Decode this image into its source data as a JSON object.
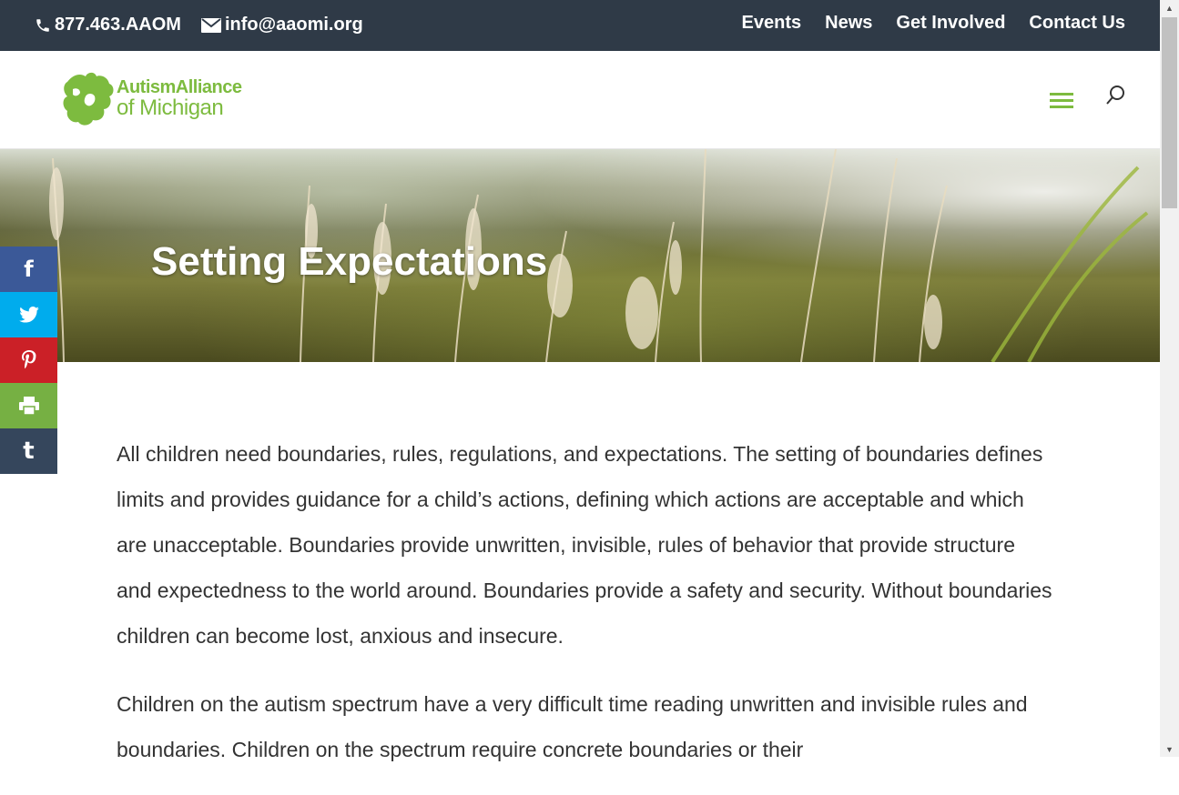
{
  "topbar": {
    "phone": "877.463.AAOM",
    "email": "info@aaomi.org",
    "nav": [
      {
        "label": "Events"
      },
      {
        "label": "News"
      },
      {
        "label": "Get Involved"
      },
      {
        "label": "Contact Us"
      }
    ]
  },
  "header": {
    "logo_line1": "AutismAlliance",
    "logo_line2": "of Michigan"
  },
  "hero": {
    "title": "Setting Expectations"
  },
  "social": [
    {
      "name": "facebook",
      "glyph": "f"
    },
    {
      "name": "twitter",
      "glyph": ""
    },
    {
      "name": "pinterest",
      "glyph": ""
    },
    {
      "name": "print",
      "glyph": ""
    },
    {
      "name": "tumblr",
      "glyph": "t"
    }
  ],
  "content": {
    "paragraphs": [
      "All children need boundaries, rules, regulations, and expectations. The setting of boundaries defines limits and provides guidance for a child’s actions, defining which actions are acceptable and which are unacceptable. Boundaries provide unwritten, invisible, rules of behavior that provide structure and expectedness to the world around. Boundaries provide a safety and security. Without boundaries children can become lost, anxious and insecure.",
      "Children on the autism spectrum have a very difficult time reading unwritten and invisible rules and boundaries. Children on the spectrum require concrete boundaries or their"
    ]
  },
  "colors": {
    "topbar_bg": "#2f3a47",
    "brand_green": "#7dbb3f",
    "facebook": "#3b5998",
    "twitter": "#00aced",
    "pinterest": "#cb2027",
    "print": "#76b043",
    "tumblr": "#35465c"
  }
}
